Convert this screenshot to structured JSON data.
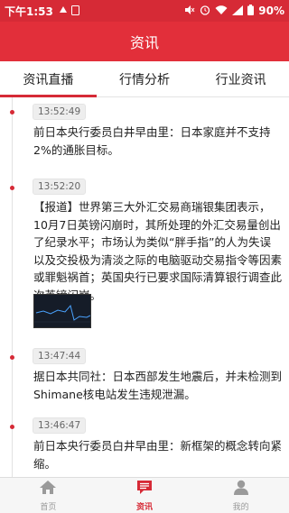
{
  "status_bar": {
    "time": "下午1:53",
    "battery": "90%",
    "icons": [
      "notification-icon",
      "sim-icon",
      "mute-icon",
      "alarm-icon",
      "wifi-icon",
      "signal-icon",
      "battery-icon"
    ]
  },
  "header": {
    "title": "资讯"
  },
  "tabs": [
    {
      "label": "资讯直播",
      "active": true
    },
    {
      "label": "行情分析",
      "active": false
    },
    {
      "label": "行业资讯",
      "active": false
    }
  ],
  "feed": {
    "items": [
      {
        "time": "13:52:49",
        "text": "前日本央行委员白井早由里：日本家庭并不支持2%的通胀目标。"
      },
      {
        "time": "13:52:20",
        "text": "【报道】世界第三大外汇交易商瑞银集团表示，10月7日英镑闪崩时，其所处理的外汇交易量创出了纪录水平；市场认为类似“胖手指”的人为失误以及交投极为清淡之际的电脑驱动交易指令等因素或罪魁祸首；英国央行已要求国际清算银行调查此次英镑闪崩。",
        "has_image": true
      },
      {
        "time": "13:47:44",
        "text": "据日本共同社：日本西部发生地震后，并未检测到Shimane核电站发生违规泄漏。"
      },
      {
        "time": "13:46:47",
        "text": "前日本央行委员白井早由里：新框架的概念转向紧缩。"
      }
    ]
  },
  "bottom_nav": [
    {
      "label": "首页",
      "icon": "home-icon",
      "active": false
    },
    {
      "label": "资讯",
      "icon": "news-icon",
      "active": true
    },
    {
      "label": "我的",
      "icon": "profile-icon",
      "active": false
    }
  ],
  "colors": {
    "accent": "#e22f3a",
    "status_bar": "#d62a36"
  }
}
